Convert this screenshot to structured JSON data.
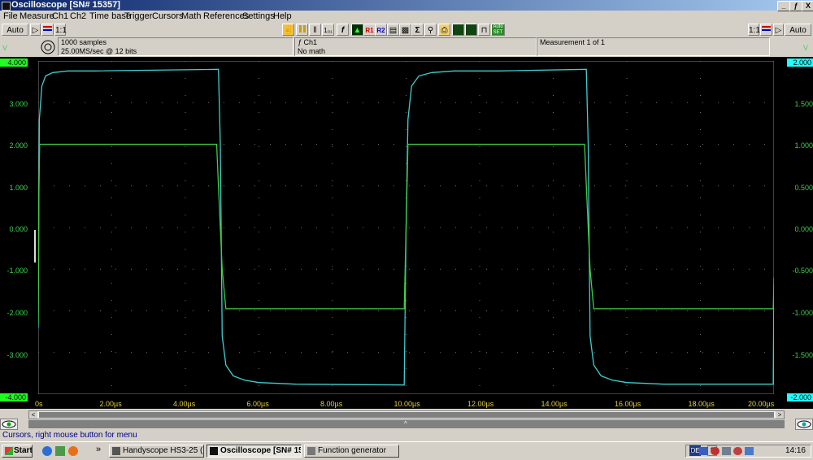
{
  "window": {
    "title": "Oscilloscope  [SN# 15357]",
    "controls": [
      "_",
      "ƒ",
      "X"
    ]
  },
  "menu": [
    "File",
    "Measure",
    "Ch1",
    "Ch2",
    "Time base",
    "Trigger",
    "Cursors",
    "Math",
    "References",
    "Settings",
    "Help"
  ],
  "toolbar": {
    "left_auto": "Auto",
    "right_auto": "Auto",
    "ref1": "R1",
    "ref2": "R2",
    "autoset": "Auto SET",
    "scale_1_1": "1:1"
  },
  "info": {
    "samples": "1000 samples",
    "rate": "25.00MS/sec @ 12 bits",
    "channel": "Ch1",
    "math": "No math",
    "measurement": "Measurement 1 of 1"
  },
  "axes": {
    "left_unit": "V",
    "right_unit": "V",
    "left_ticks": [
      "4.000",
      "3.000",
      "2.000",
      "1.000",
      "0.000",
      "-1.000",
      "-2.000",
      "-3.000",
      "-4.000"
    ],
    "right_ticks": [
      "2.000",
      "1.500",
      "1.000",
      "0.500",
      "0.000",
      "-0.500",
      "-1.000",
      "-1.500",
      "-2.000"
    ],
    "x_ticks": [
      "0s",
      "2.00µs",
      "4.00µs",
      "6.00µs",
      "8.00µs",
      "10.00µs",
      "12.00µs",
      "14.00µs",
      "16.00µs",
      "18.00µs",
      "20.00µs"
    ]
  },
  "colors": {
    "ch1": "#3fcf3f",
    "ch2": "#3fcfcf",
    "grid": "#707070",
    "xlabels": "#e5cf3e",
    "left_range_bg": "#20ff20",
    "right_range_bg": "#20ffff"
  },
  "chart_data": {
    "type": "line",
    "x_unit": "µs",
    "xlim": [
      0,
      20
    ],
    "ylim_left": [
      -4,
      4
    ],
    "ylim_right": [
      -2,
      2
    ],
    "series": [
      {
        "name": "Ch1",
        "axis": "left",
        "x": [
          0,
          0.02,
          0.04,
          4.85,
          4.9,
          5.0,
          5.1,
          9.95,
          10.0,
          10.05,
          14.85,
          14.9,
          15.0,
          15.1,
          19.98,
          20.0
        ],
        "y": [
          -2.3,
          1.0,
          2.0,
          2.0,
          1.0,
          -1.0,
          -1.95,
          -1.95,
          0.0,
          2.0,
          2.0,
          1.0,
          -1.0,
          -1.95,
          -1.95,
          -1.3
        ]
      },
      {
        "name": "Ch2",
        "axis": "right",
        "x": [
          0,
          0.03,
          0.1,
          0.2,
          0.4,
          0.8,
          1.5,
          4.9,
          4.95,
          5.0,
          5.1,
          5.3,
          5.6,
          6.0,
          7.0,
          9.95,
          10.0,
          10.05,
          10.15,
          10.35,
          10.7,
          11.3,
          12.5,
          14.9,
          14.95,
          15.0,
          15.1,
          15.3,
          15.6,
          16.0,
          17.0,
          19.98,
          20.0
        ],
        "y": [
          -1.2,
          1.3,
          1.7,
          1.82,
          1.86,
          1.88,
          1.88,
          1.9,
          1.0,
          -1.3,
          -1.65,
          -1.78,
          -1.83,
          -1.86,
          -1.88,
          -1.89,
          0.0,
          1.3,
          1.7,
          1.82,
          1.86,
          1.88,
          1.88,
          1.9,
          1.0,
          -1.3,
          -1.65,
          -1.78,
          -1.83,
          -1.86,
          -1.88,
          -1.88,
          -0.6
        ]
      }
    ]
  },
  "scroll": {
    "left_arrow": "<",
    "right_arrow": ">",
    "caret": "^"
  },
  "status": "Cursors, right mouse button for menu",
  "taskbar": {
    "start": "Start",
    "chevron": "»",
    "tasks": [
      "Handyscope HS3-25 (US...",
      "Oscilloscope  [SN# 15...",
      "Function generator"
    ],
    "lang": "DE",
    "tray_chevron": "«",
    "time": "14:16"
  }
}
